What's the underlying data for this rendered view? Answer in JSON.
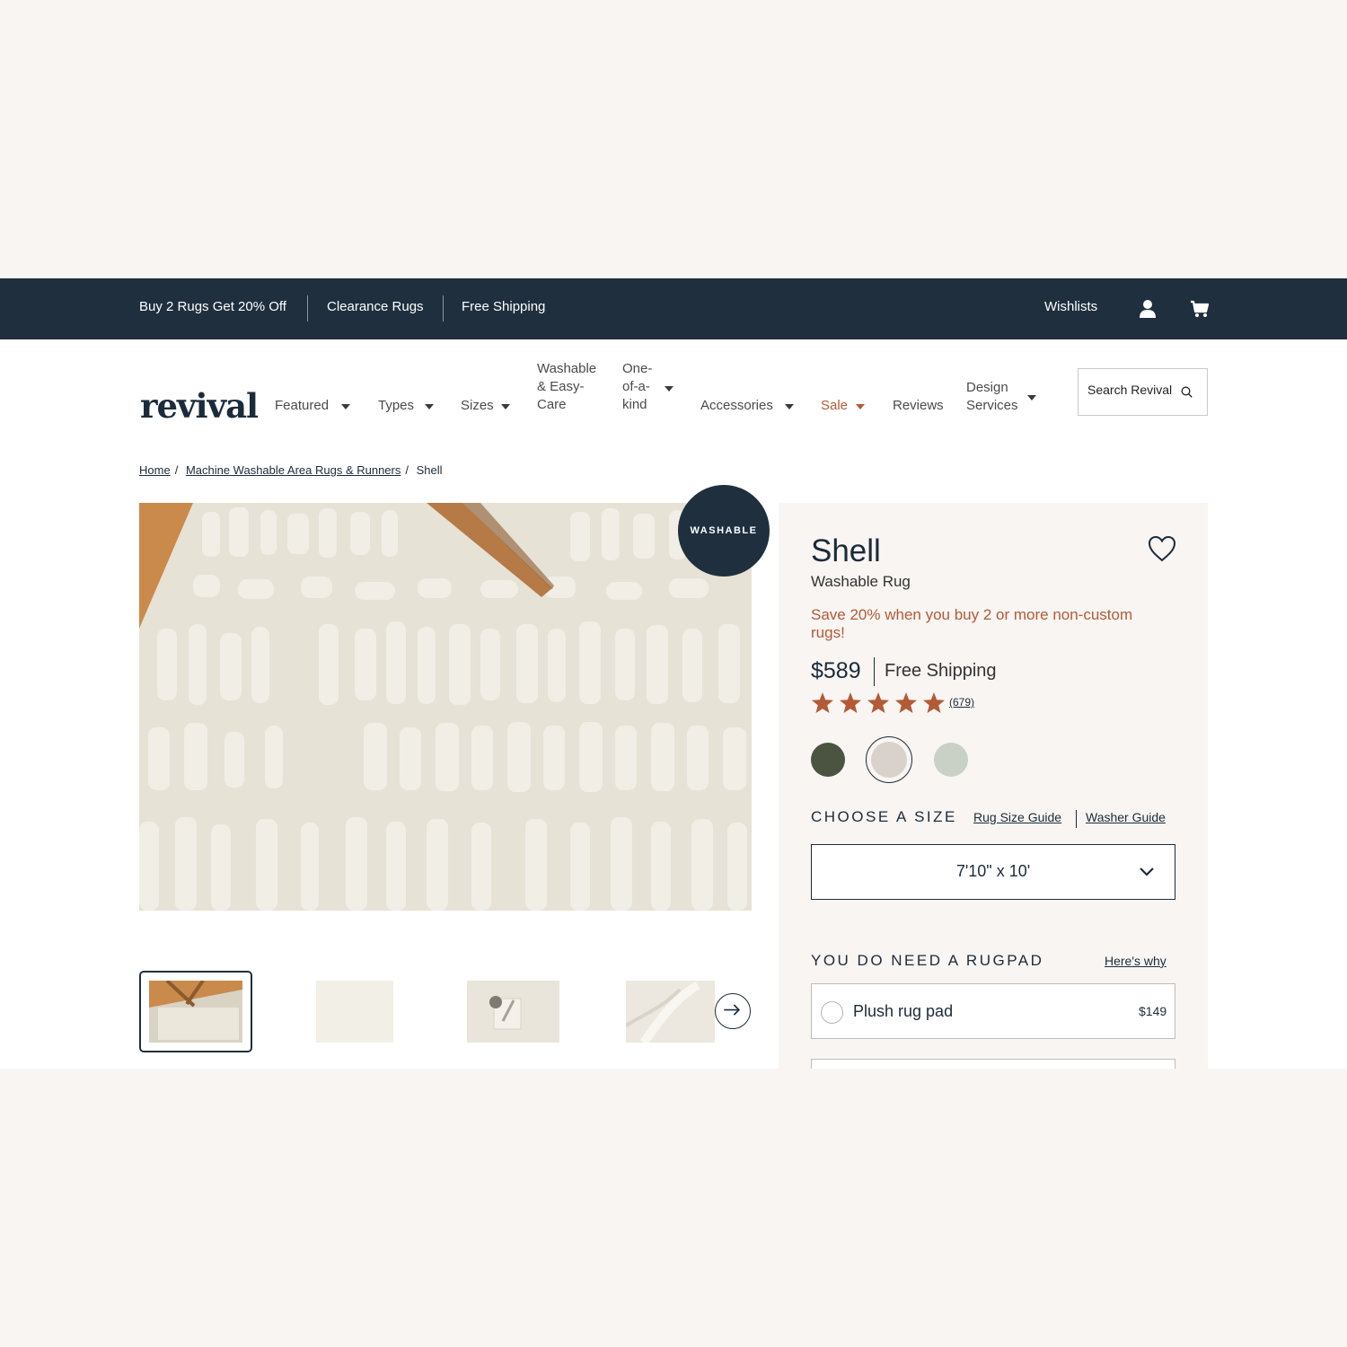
{
  "topbar": {
    "promos": [
      "Buy 2 Rugs Get 20% Off",
      "Clearance Rugs",
      "Free Shipping"
    ],
    "wishlists_label": "Wishlists",
    "user_icon": "user-icon",
    "cart_icon": "cart-icon"
  },
  "header": {
    "logo": "revival",
    "nav": {
      "featured": "Featured",
      "types": "Types",
      "sizes": "Sizes",
      "washable_1": "Washable",
      "washable_2": "& Easy-",
      "washable_3": "Care",
      "oneofakind_1": "One-",
      "oneofakind_2": "of-a-",
      "oneofakind_3": "kind",
      "accessories": "Accessories",
      "sale": "Sale",
      "reviews": "Reviews",
      "design_1": "Design",
      "design_2": "Services"
    },
    "search_placeholder": "Search Revival"
  },
  "breadcrumb": {
    "home": "Home",
    "category": "Machine Washable Area Rugs & Runners",
    "current": "Shell"
  },
  "gallery": {
    "badge": "WASHABLE",
    "thumbnail_count": 4,
    "active_thumbnail": 1
  },
  "product": {
    "title": "Shell",
    "subtitle": "Washable Rug",
    "promo": "Save 20% when you buy 2 or more non-custom rugs!",
    "price": "$589",
    "shipping": "Free Shipping",
    "rating": 5,
    "review_count": "(679)",
    "swatches": [
      "#4a5441",
      "#d9d1cc",
      "#c9d1c6"
    ],
    "selected_swatch": 1,
    "size_heading": "CHOOSE A SIZE",
    "size_guide_link": "Rug Size Guide",
    "washer_guide_link": "Washer Guide",
    "selected_size": "7'10\" x 10'",
    "rugpad_heading": "YOU DO NEED A RUGPAD",
    "rugpad_link": "Here's why",
    "rugpad_option": "Plush rug pad",
    "rugpad_price": "$149"
  },
  "colors": {
    "navy": "#1f2f3e",
    "accent": "#b35a37",
    "panel_bg": "#f8f5f2"
  }
}
